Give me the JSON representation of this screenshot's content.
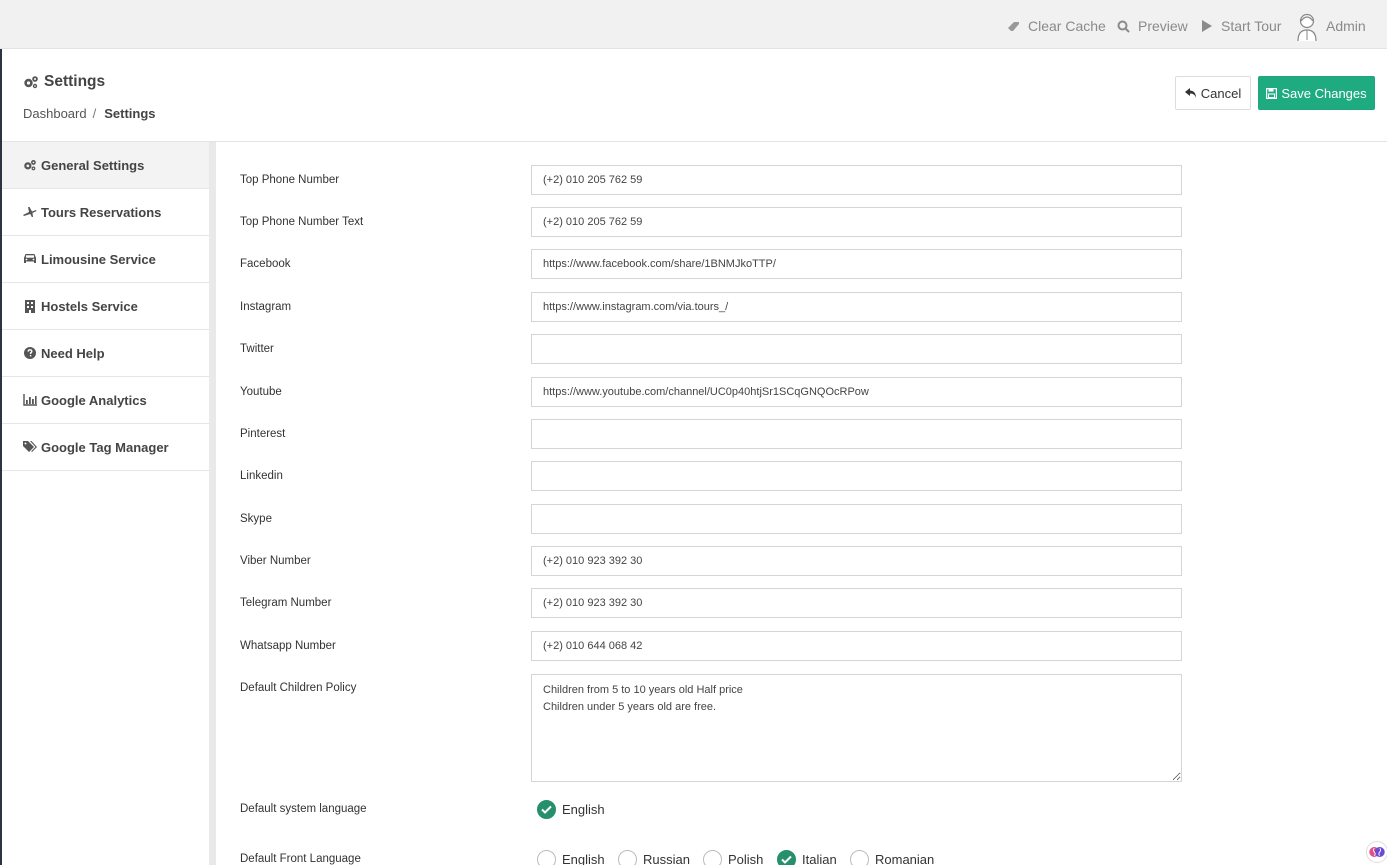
{
  "topbar": {
    "clear_cache": "Clear Cache",
    "preview": "Preview",
    "start_tour": "Start Tour",
    "user": "Admin"
  },
  "header": {
    "title": "Settings",
    "breadcrumb_home": "Dashboard",
    "breadcrumb_sep": "/",
    "breadcrumb_current": "Settings",
    "cancel_label": "Cancel",
    "save_label": "Save Changes"
  },
  "sidebar": {
    "items": [
      {
        "label": "General Settings",
        "icon": "gears-icon"
      },
      {
        "label": "Tours Reservations",
        "icon": "plane-icon"
      },
      {
        "label": "Limousine Service",
        "icon": "car-icon"
      },
      {
        "label": "Hostels Service",
        "icon": "building-icon"
      },
      {
        "label": "Need Help",
        "icon": "question-circle-icon"
      },
      {
        "label": "Google Analytics",
        "icon": "bar-chart-icon"
      },
      {
        "label": "Google Tag Manager",
        "icon": "tags-icon"
      }
    ]
  },
  "form": {
    "fields": [
      {
        "label": "Top Phone Number",
        "value": "(+2) 010 205 762 59"
      },
      {
        "label": "Top Phone Number Text",
        "value": "(+2) 010 205 762 59"
      },
      {
        "label": "Facebook",
        "value": "https://www.facebook.com/share/1BNMJkoTTP/"
      },
      {
        "label": "Instagram",
        "value": "https://www.instagram.com/via.tours_/"
      },
      {
        "label": "Twitter",
        "value": ""
      },
      {
        "label": "Youtube",
        "value": "https://www.youtube.com/channel/UC0p40htjSr1SCqGNQOcRPow"
      },
      {
        "label": "Pinterest",
        "value": ""
      },
      {
        "label": "Linkedin",
        "value": ""
      },
      {
        "label": "Skype",
        "value": ""
      },
      {
        "label": "Viber Number",
        "value": "(+2) 010 923 392 30"
      },
      {
        "label": "Telegram Number",
        "value": "(+2) 010 923 392 30"
      },
      {
        "label": "Whatsapp Number",
        "value": "(+2) 010 644 068 42"
      }
    ],
    "children_policy": {
      "label": "Default Children Policy",
      "value": "Children from 5 to 10 years old Half price\nChildren under 5 years old are free."
    },
    "system_language": {
      "label": "Default system language",
      "options": [
        {
          "label": "English",
          "checked": true
        }
      ]
    },
    "front_language": {
      "label": "Default Front Language",
      "options": [
        {
          "label": "English",
          "checked": false
        },
        {
          "label": "Russian",
          "checked": false
        },
        {
          "label": "Polish",
          "checked": false
        },
        {
          "label": "Italian",
          "checked": true
        },
        {
          "label": "Romanian",
          "checked": false
        }
      ]
    }
  },
  "colors": {
    "accent": "#1fab80",
    "checked": "#26906c"
  }
}
